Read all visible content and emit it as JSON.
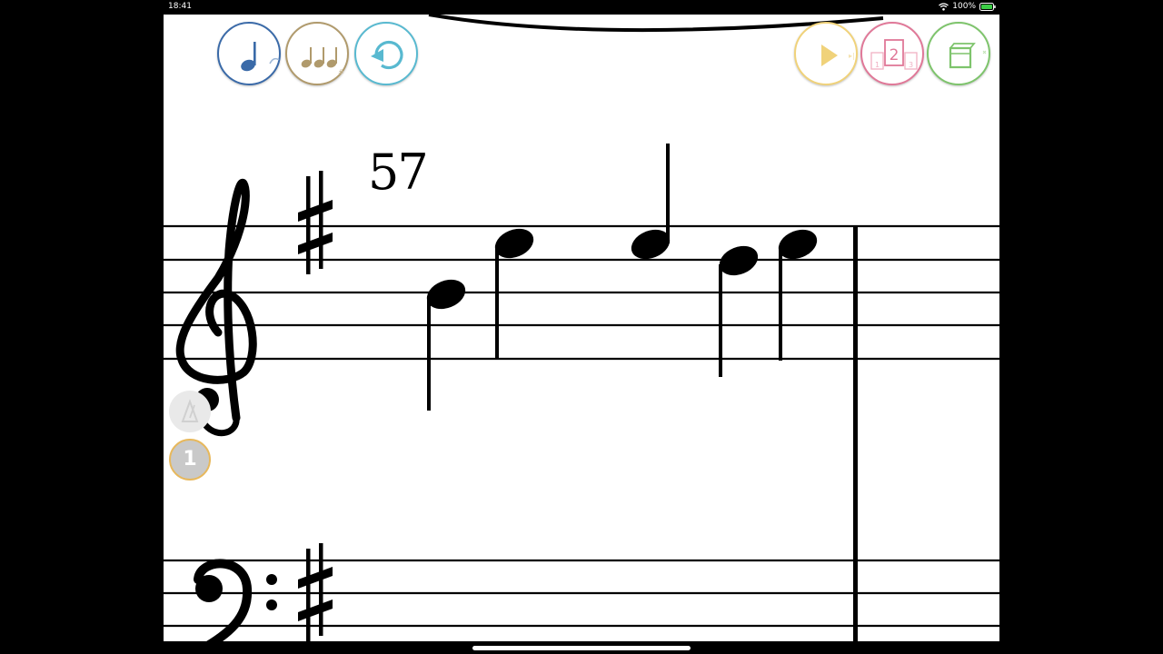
{
  "status": {
    "time": "18:41",
    "battery": "100%"
  },
  "score": {
    "measure_number": "57"
  },
  "sidebar": {
    "voice_number": "1"
  },
  "toolbar": {
    "note_icon": "quarter-note-icon",
    "rhythm_icon": "three-notes-icon",
    "undo_icon": "undo-icon",
    "play_icon": "play-icon",
    "pages_icon": "pages-icon",
    "book_icon": "book-icon",
    "pages_label_main": "2",
    "pages_label_left": "1",
    "pages_label_right": "3"
  },
  "colors": {
    "note_button": "#3a6aa8",
    "rhythm_button": "#b09a6c",
    "undo_button": "#58b9d0",
    "play_button": "#f0d27a",
    "pages_button": "#e07898",
    "book_button": "#7ec46c",
    "voice_badge": "#e7b85c"
  }
}
